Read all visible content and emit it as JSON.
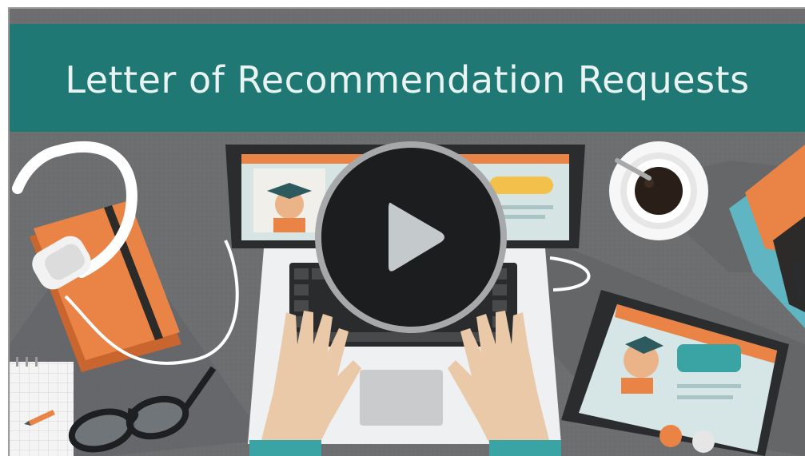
{
  "video": {
    "title": "Letter of Recommendation Requests",
    "play_icon": "play-icon"
  },
  "colors": {
    "title_bar": "#1f7873",
    "title_text": "#e8f3f2",
    "desk": "#6d6e70",
    "play_circle": "#1b1d1f",
    "play_ring": "#a6a8aa",
    "play_triangle": "#c4c9cb"
  }
}
